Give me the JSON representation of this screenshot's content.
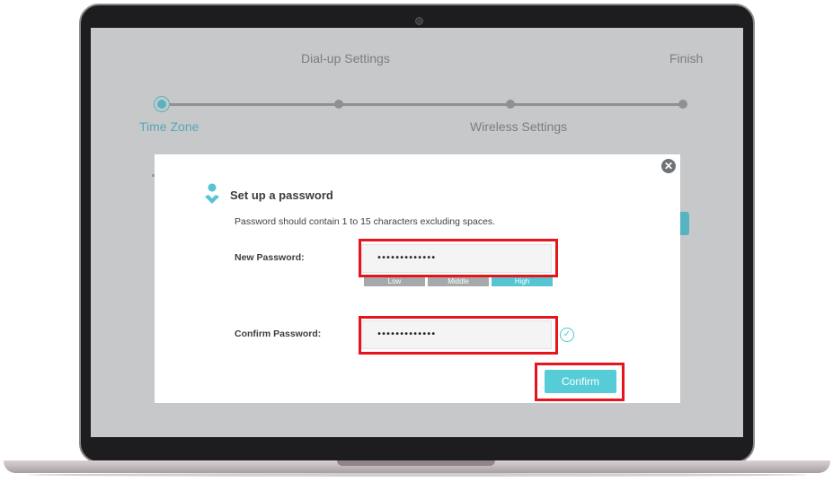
{
  "wizard": {
    "steps": [
      {
        "label": "Time Zone",
        "active": true
      },
      {
        "label": "Dial-up Settings",
        "active": false
      },
      {
        "label": "Wireless Settings",
        "active": false
      },
      {
        "label": "Finish",
        "active": false
      }
    ]
  },
  "modal": {
    "title": "Set up a password",
    "close_icon": "close-icon",
    "hint": "Password should contain 1 to 15 characters excluding spaces.",
    "new_password": {
      "label": "New Password:",
      "value": "•••••••••••••"
    },
    "strength": {
      "levels": [
        "Low",
        "Middle",
        "High"
      ],
      "current": "High"
    },
    "confirm_password": {
      "label": "Confirm Password:",
      "value": "•••••••••••••"
    },
    "match_icon": "check-circle-icon",
    "confirm_label": "Confirm"
  },
  "colors": {
    "accent": "#56c4d2",
    "highlight": "#e8141b"
  }
}
